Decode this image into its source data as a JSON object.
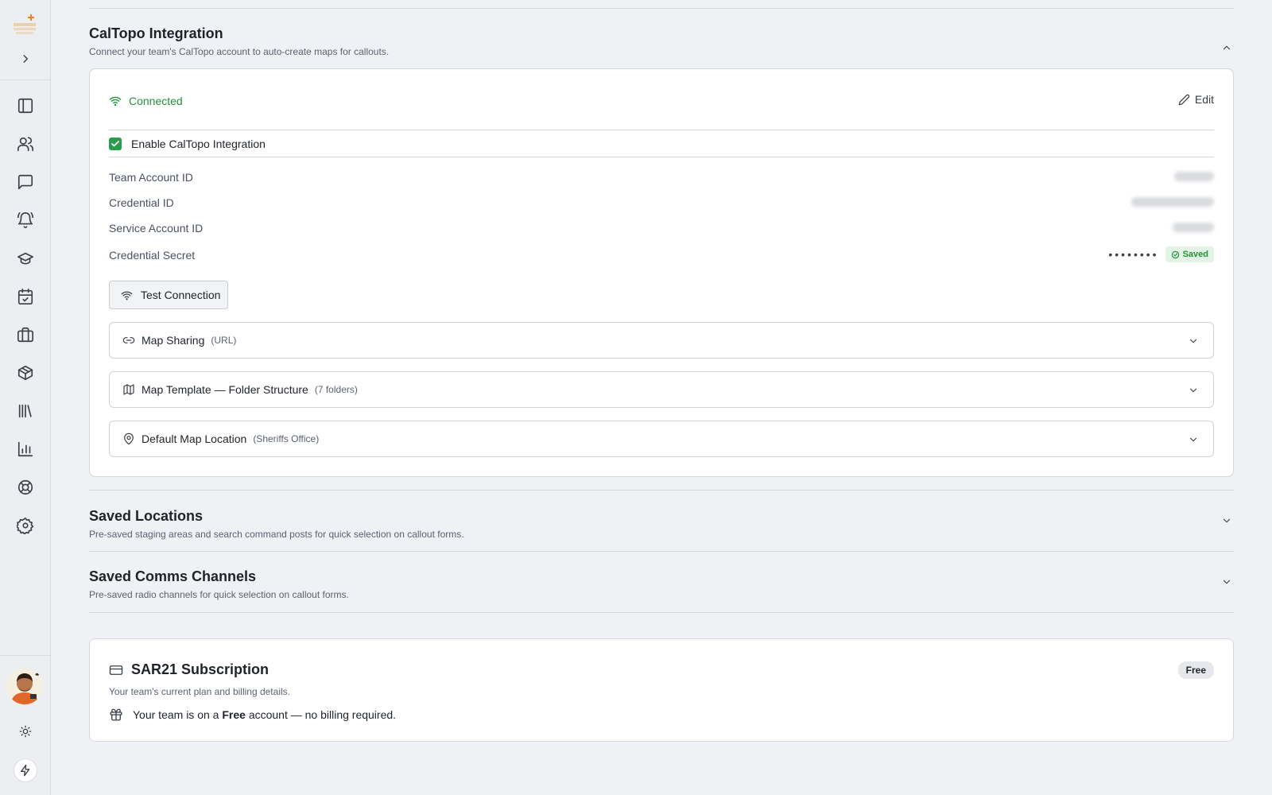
{
  "sidebar": {
    "items": [
      {
        "name": "layout-panel"
      },
      {
        "name": "members"
      },
      {
        "name": "messages"
      },
      {
        "name": "alerts"
      },
      {
        "name": "training"
      },
      {
        "name": "calendar"
      },
      {
        "name": "equipment"
      },
      {
        "name": "inventory"
      },
      {
        "name": "library"
      },
      {
        "name": "reports"
      },
      {
        "name": "support"
      },
      {
        "name": "settings"
      }
    ]
  },
  "caltopo": {
    "title": "CalTopo Integration",
    "description": "Connect your team's CalTopo account to auto-create maps for callouts.",
    "status": "Connected",
    "edit_label": "Edit",
    "enable_label": "Enable CalTopo Integration",
    "enabled": true,
    "fields": {
      "team_account_id": "Team Account ID",
      "credential_id": "Credential ID",
      "service_account_id": "Service Account ID",
      "credential_secret": "Credential Secret"
    },
    "secret_mask": "••••••••",
    "saved_label": "Saved",
    "test_button": "Test Connection",
    "accordions": {
      "map_sharing": {
        "title": "Map Sharing",
        "sub": "(URL)"
      },
      "map_template": {
        "title": "Map Template — Folder Structure",
        "sub": "(7 folders)"
      },
      "default_location": {
        "title": "Default Map Location",
        "sub": "(Sheriffs Office)"
      }
    }
  },
  "saved_locations": {
    "title": "Saved Locations",
    "description": "Pre-saved staging areas and search command posts for quick selection on callout forms."
  },
  "saved_comms": {
    "title": "Saved Comms Channels",
    "description": "Pre-saved radio channels for quick selection on callout forms."
  },
  "subscription": {
    "title": "SAR21 Subscription",
    "badge": "Free",
    "description": "Your team's current plan and billing details.",
    "message_prefix": "Your team is on a",
    "plan": "Free",
    "message_suffix": "account — no billing required."
  },
  "colors": {
    "accent_green": "#22913a",
    "checkbox_green": "#2a9d4a",
    "background": "#f0f1f4"
  }
}
